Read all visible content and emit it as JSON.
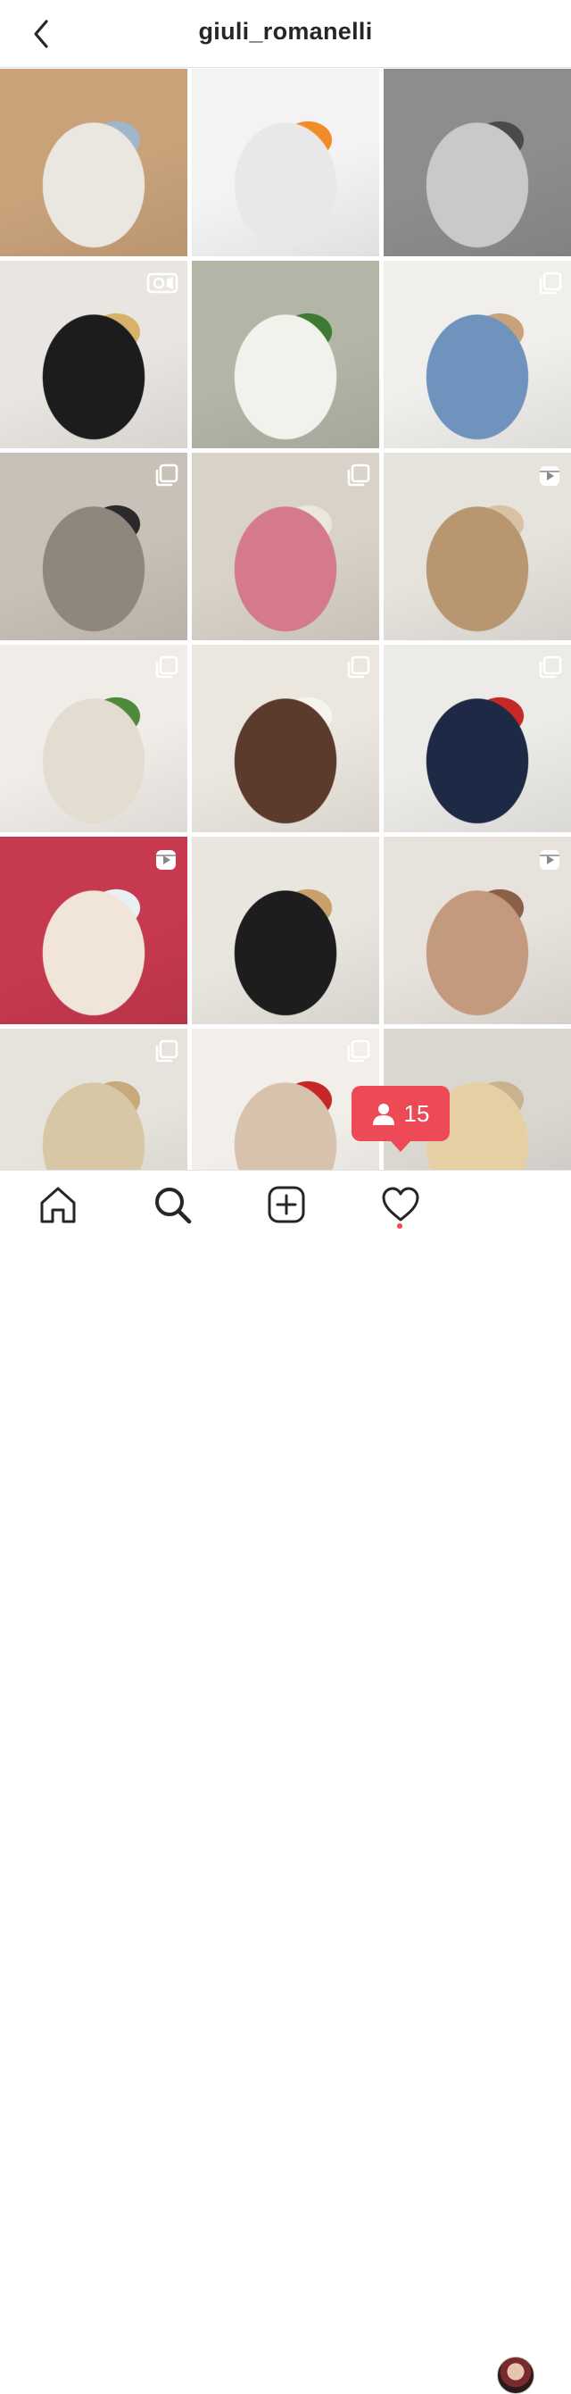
{
  "header": {
    "title": "giuli_romanelli",
    "back_icon": "chevron-left-icon"
  },
  "grid": {
    "posts": [
      {
        "name": "post-beige-blazer-bag",
        "badge": "none",
        "colors": [
          "#c9a27a",
          "#eae6e0",
          "#9fb7c9"
        ]
      },
      {
        "name": "post-supplement-box",
        "badge": "none",
        "colors": [
          "#f3f3f3",
          "#e8e8e8",
          "#f28c28"
        ]
      },
      {
        "name": "post-beach-sand-bw",
        "badge": "none",
        "colors": [
          "#8d8d8d",
          "#c9c9c9",
          "#4a4a4a"
        ]
      },
      {
        "name": "post-chanel-bag",
        "badge": "igtv",
        "colors": [
          "#e9e6e1",
          "#1c1c1c",
          "#d9b26a"
        ]
      },
      {
        "name": "post-white-tulips",
        "badge": "none",
        "colors": [
          "#b3b6a7",
          "#f2f2ec",
          "#3d7a35"
        ]
      },
      {
        "name": "post-denim-selfie",
        "badge": "multi",
        "colors": [
          "#f1efec",
          "#6f93bd",
          "#c9a27a"
        ]
      },
      {
        "name": "post-shelf-decor",
        "badge": "multi",
        "colors": [
          "#c8c1b8",
          "#8f877e",
          "#2a2a2a"
        ]
      },
      {
        "name": "post-pink-shirt-sofa",
        "badge": "multi",
        "colors": [
          "#d9d2c9",
          "#d47a8b",
          "#ece7dd"
        ]
      },
      {
        "name": "post-hair-bun",
        "badge": "reels",
        "colors": [
          "#e6e2dc",
          "#b89770",
          "#d9c1a4"
        ]
      },
      {
        "name": "post-white-knit",
        "badge": "multi",
        "colors": [
          "#f0ede8",
          "#e3dcd0",
          "#4f8a3c"
        ]
      },
      {
        "name": "post-white-trousers",
        "badge": "multi",
        "colors": [
          "#ebe6de",
          "#5a3b2c",
          "#f7f4ee"
        ]
      },
      {
        "name": "post-striped-sweater-red-bag",
        "badge": "multi",
        "colors": [
          "#ecebe8",
          "#1e2a45",
          "#c62828"
        ]
      },
      {
        "name": "post-restorate-products",
        "badge": "reels",
        "colors": [
          "#c7394e",
          "#f1e4d8",
          "#e9f0f4"
        ]
      },
      {
        "name": "post-black-dress-selfie",
        "badge": "none",
        "colors": [
          "#e9e5df",
          "#1d1d1d",
          "#c7a06a"
        ]
      },
      {
        "name": "post-hand-face-portrait",
        "badge": "reels",
        "colors": [
          "#e7e2dc",
          "#c49a7e",
          "#8a6048"
        ]
      },
      {
        "name": "post-trench-back",
        "badge": "multi",
        "colors": [
          "#e6e2dc",
          "#d8c7a4",
          "#c7a97b"
        ]
      },
      {
        "name": "post-bracelets",
        "badge": "multi",
        "colors": [
          "#f2eeea",
          "#d7c2ad",
          "#c62828"
        ]
      },
      {
        "name": "post-chanel-heels",
        "badge": "none",
        "colors": [
          "#dad7d1",
          "#e7cfa4",
          "#c8b38c"
        ]
      }
    ]
  },
  "notification": {
    "count": "15",
    "icon": "person-icon"
  },
  "tabbar": {
    "items": [
      {
        "name": "tab-home",
        "icon": "home-icon"
      },
      {
        "name": "tab-search",
        "icon": "search-icon"
      },
      {
        "name": "tab-new-post",
        "icon": "plus-square-icon"
      },
      {
        "name": "tab-activity",
        "icon": "heart-icon"
      },
      {
        "name": "tab-profile",
        "icon": "avatar"
      }
    ]
  },
  "colors": {
    "accent": "#ed4956",
    "text": "#262626",
    "divider": "#e3e3e3"
  }
}
